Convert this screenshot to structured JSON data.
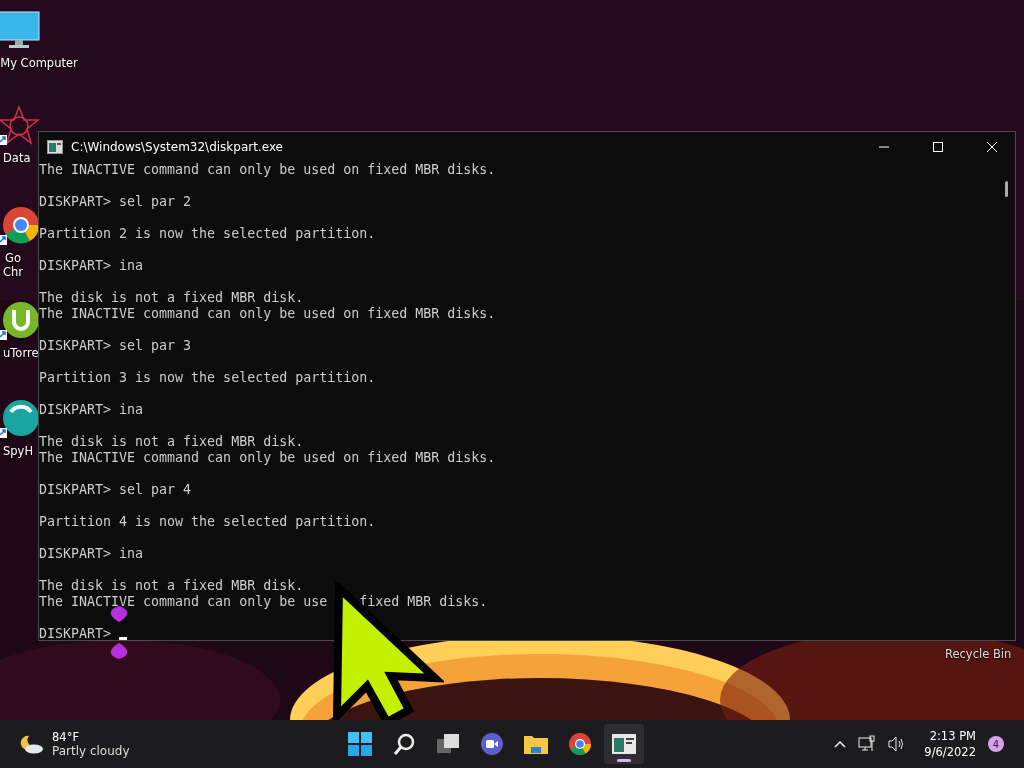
{
  "desktop_icons": [
    {
      "kind": "monitor",
      "lines": [
        "My Computer"
      ]
    },
    {
      "kind": "star",
      "lines": [
        "Data"
      ]
    },
    {
      "kind": "chrome",
      "lines": [
        "Go",
        "Chr"
      ]
    },
    {
      "kind": "torrent",
      "lines": [
        "uTorre"
      ]
    },
    {
      "kind": "spy",
      "lines": [
        "SpyH"
      ]
    }
  ],
  "recycle_bin": {
    "label": "Recycle Bin"
  },
  "window": {
    "title": "C:\\Windows\\System32\\diskpart.exe",
    "blocks": [
      [
        "The INACTIVE command can only be used on fixed MBR disks."
      ],
      [
        "DISKPART> sel par 2"
      ],
      [
        "Partition 2 is now the selected partition."
      ],
      [
        "DISKPART> ina"
      ],
      [
        "The disk is not a fixed MBR disk.",
        "The INACTIVE command can only be used on fixed MBR disks."
      ],
      [
        "DISKPART> sel par 3"
      ],
      [
        "Partition 3 is now the selected partition."
      ],
      [
        "DISKPART> ina"
      ],
      [
        "The disk is not a fixed MBR disk.",
        "The INACTIVE command can only be used on fixed MBR disks."
      ],
      [
        "DISKPART> sel par 4"
      ],
      [
        "Partition 4 is now the selected partition."
      ],
      [
        "DISKPART> ina"
      ],
      [
        "The disk is not a fixed MBR disk.",
        [
          "The INACTIVE command can only be use",
          "fixed MBR disks."
        ]
      ]
    ],
    "prompt": "DISKPART>"
  },
  "taskbar": {
    "weather": {
      "temperature": "84°F",
      "condition": "Partly cloudy"
    },
    "apps": [
      {
        "kind": "start",
        "selected": false
      },
      {
        "kind": "search",
        "selected": false
      },
      {
        "kind": "task-view",
        "selected": false
      },
      {
        "kind": "chat",
        "selected": false
      },
      {
        "kind": "folder",
        "selected": false
      },
      {
        "kind": "chrome",
        "selected": false
      },
      {
        "kind": "console",
        "selected": true
      }
    ],
    "clock": {
      "time": "2:13 PM",
      "date": "9/6/2022"
    },
    "notification_count": "4"
  }
}
